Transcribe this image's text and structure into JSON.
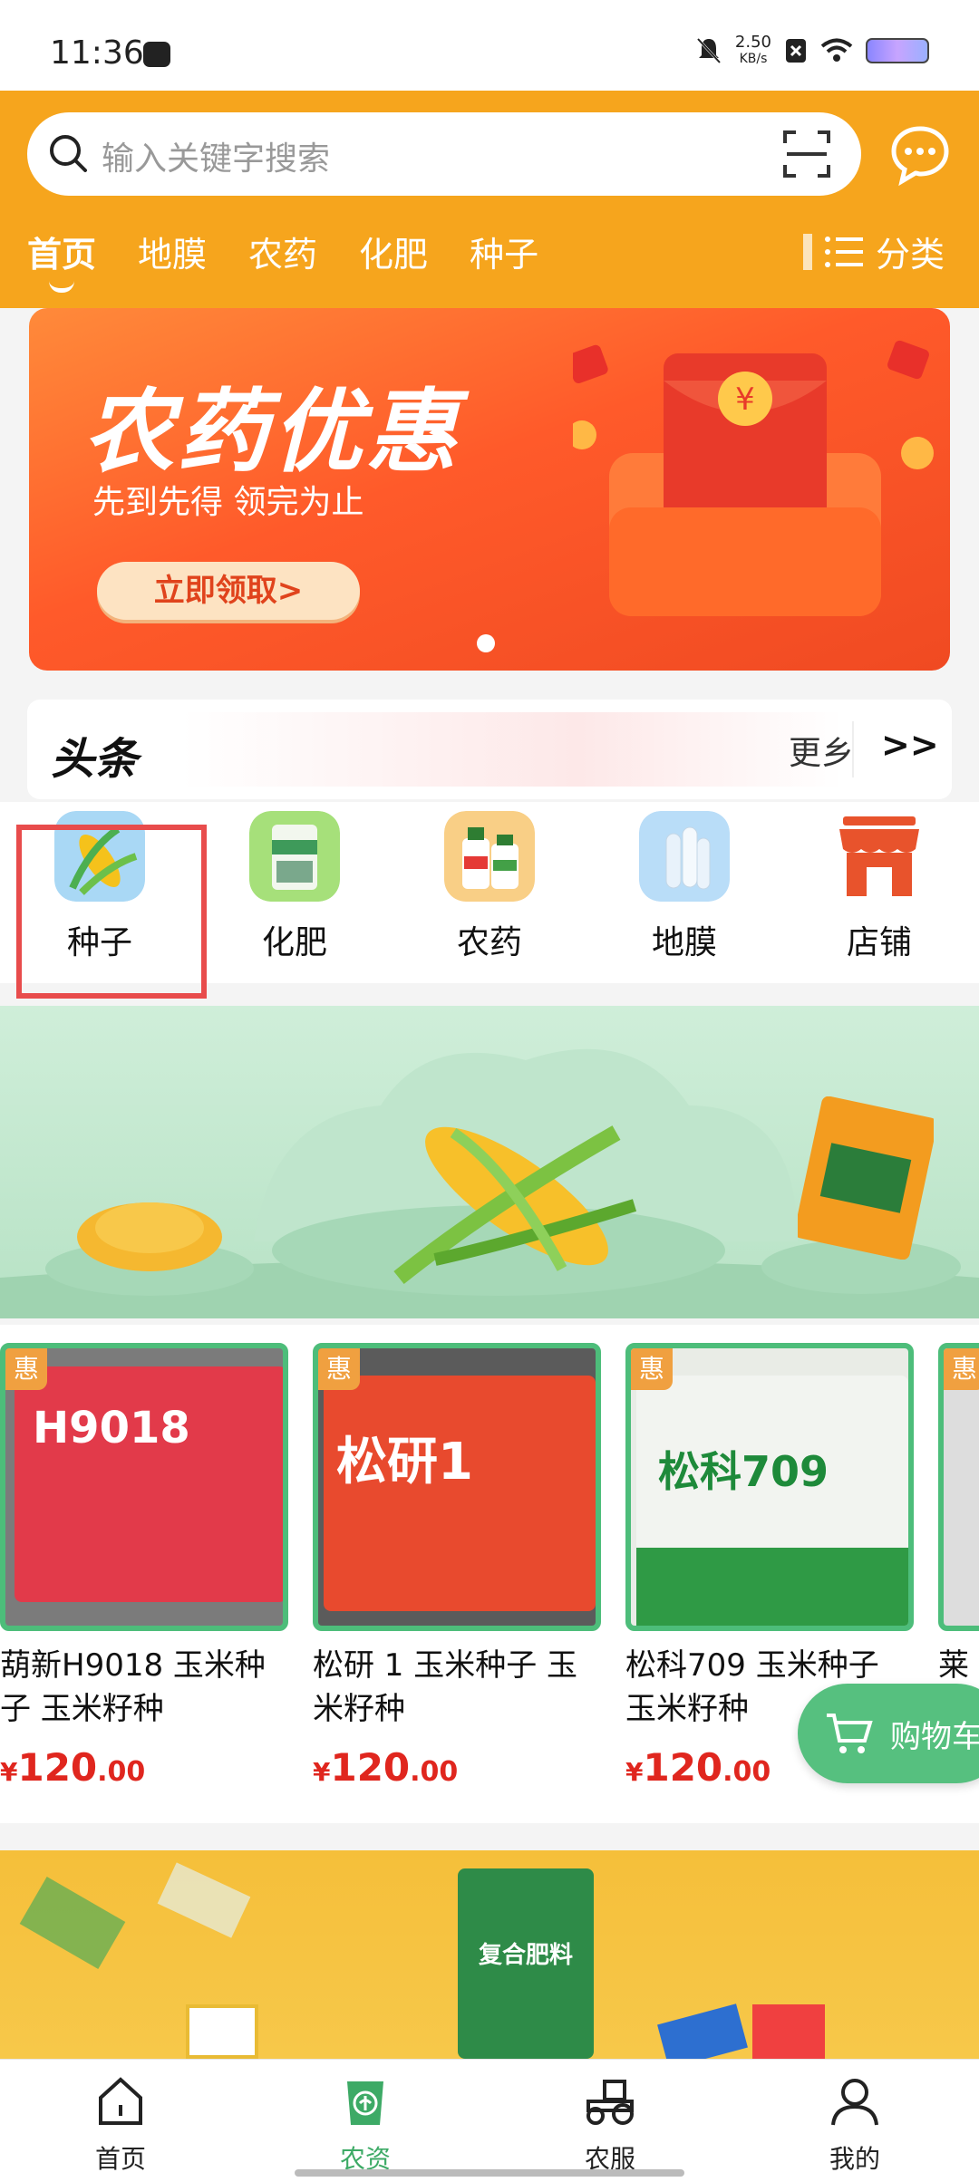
{
  "status_bar": {
    "time": "11:36",
    "speed_value": "2.50",
    "speed_unit": "KB/s"
  },
  "search": {
    "placeholder": "输入关键字搜索"
  },
  "top_tabs": [
    {
      "label": "首页",
      "active": true
    },
    {
      "label": "地膜"
    },
    {
      "label": "农药"
    },
    {
      "label": "化肥"
    },
    {
      "label": "种子"
    }
  ],
  "category_button": "分类",
  "banner": {
    "title": "农药优惠",
    "subtitle": "先到先得 领完为止",
    "button": "立即领取>"
  },
  "headline": {
    "logo": "头条",
    "more": "更乡",
    "arrow": ">>"
  },
  "categories": [
    {
      "label": "种子",
      "icon": "corn-icon"
    },
    {
      "label": "化肥",
      "icon": "fertilizer-bag-icon"
    },
    {
      "label": "农药",
      "icon": "pesticide-bottle-icon"
    },
    {
      "label": "地膜",
      "icon": "film-roll-icon"
    },
    {
      "label": "店铺",
      "icon": "store-icon"
    }
  ],
  "products": [
    {
      "badge": "惠",
      "name": "葫新H9018 玉米种子 玉米籽种",
      "price_symbol": "¥",
      "price_int": "120",
      "price_dec": ".00",
      "pack_text": "H9018"
    },
    {
      "badge": "惠",
      "name": "松研 1 玉米种子 玉米籽种",
      "price_symbol": "¥",
      "price_int": "120",
      "price_dec": ".00",
      "pack_text": "松研1"
    },
    {
      "badge": "惠",
      "name": "松科709 玉米种子 玉米籽种",
      "price_symbol": "¥",
      "price_int": "120",
      "price_dec": ".00",
      "pack_text": "松科709"
    },
    {
      "badge": "惠",
      "name": "莱"
    }
  ],
  "cart_button": "购物车",
  "promo": {
    "bag_label": "复合肥料"
  },
  "bottom_nav": [
    {
      "label": "首页"
    },
    {
      "label": "农资",
      "active": true
    },
    {
      "label": "农服"
    },
    {
      "label": "我的"
    }
  ],
  "colors": {
    "header_orange": "#f6a51d",
    "accent_green": "#3daa66",
    "price_red": "#e0261e"
  }
}
